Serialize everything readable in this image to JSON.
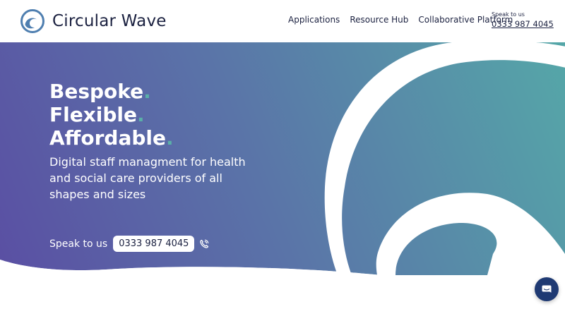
{
  "brand": {
    "name": "Circular Wave",
    "logo_icon": "wave-circle-icon"
  },
  "nav": {
    "items": [
      "Applications",
      "Resource Hub",
      "Collaborative Platform"
    ]
  },
  "contact": {
    "label": "Speak to us",
    "phone": "0333 987 4045"
  },
  "hero": {
    "tagline": [
      {
        "word": "Bespoke",
        "dot": "."
      },
      {
        "word": "Flexible",
        "dot": "."
      },
      {
        "word": "Affordable",
        "dot": "."
      }
    ],
    "subtitle": "Digital staff managment for health and social care providers of all shapes and sizes",
    "cta_label": "Speak to us",
    "cta_phone": "0333 987 4045",
    "cta_icon": "phone-ringing-icon"
  },
  "chat": {
    "icon": "chat-bubble-icon"
  },
  "colors": {
    "gradient_start": "#5a4fa3",
    "gradient_end": "#55a7a8",
    "accent_dot": "#5ab0a8",
    "brand_text": "#1b2140",
    "chat_button": "#1f3a73"
  }
}
